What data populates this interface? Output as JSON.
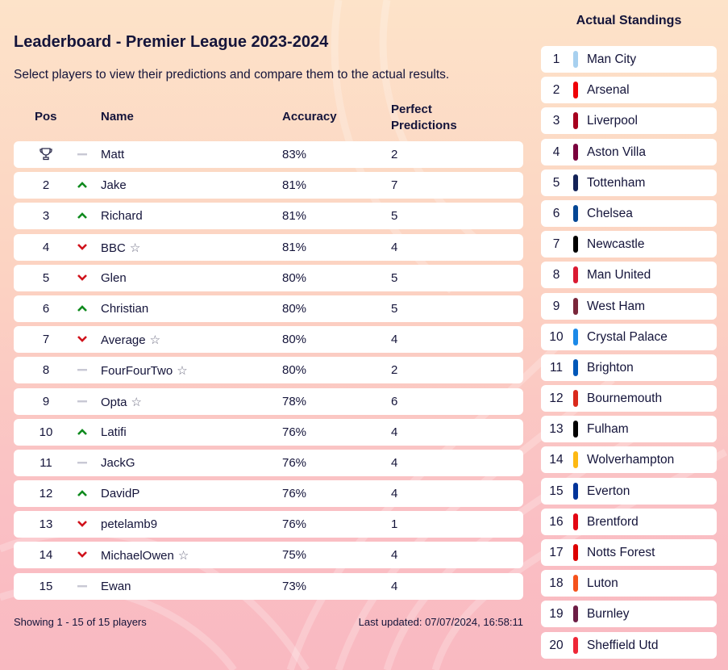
{
  "leaderboard": {
    "title": "Leaderboard - Premier League 2023-2024",
    "subtitle": "Select players to view their predictions and compare them to the actual results.",
    "columns": {
      "pos": "Pos",
      "name": "Name",
      "accuracy": "Accuracy",
      "perfect_line1": "Perfect",
      "perfect_line2": "Predictions"
    },
    "rows": [
      {
        "pos": "1",
        "trophy": true,
        "trend": "same",
        "name": "Matt",
        "star": false,
        "accuracy": "83%",
        "perfect": "2"
      },
      {
        "pos": "2",
        "trophy": false,
        "trend": "up",
        "name": "Jake",
        "star": false,
        "accuracy": "81%",
        "perfect": "7"
      },
      {
        "pos": "3",
        "trophy": false,
        "trend": "up",
        "name": "Richard",
        "star": false,
        "accuracy": "81%",
        "perfect": "5"
      },
      {
        "pos": "4",
        "trophy": false,
        "trend": "down",
        "name": "BBC",
        "star": true,
        "accuracy": "81%",
        "perfect": "4"
      },
      {
        "pos": "5",
        "trophy": false,
        "trend": "down",
        "name": "Glen",
        "star": false,
        "accuracy": "80%",
        "perfect": "5"
      },
      {
        "pos": "6",
        "trophy": false,
        "trend": "up",
        "name": "Christian",
        "star": false,
        "accuracy": "80%",
        "perfect": "5"
      },
      {
        "pos": "7",
        "trophy": false,
        "trend": "down",
        "name": "Average",
        "star": true,
        "accuracy": "80%",
        "perfect": "4"
      },
      {
        "pos": "8",
        "trophy": false,
        "trend": "same",
        "name": "FourFourTwo",
        "star": true,
        "accuracy": "80%",
        "perfect": "2"
      },
      {
        "pos": "9",
        "trophy": false,
        "trend": "same",
        "name": "Opta",
        "star": true,
        "accuracy": "78%",
        "perfect": "6"
      },
      {
        "pos": "10",
        "trophy": false,
        "trend": "up",
        "name": "Latifi",
        "star": false,
        "accuracy": "76%",
        "perfect": "4"
      },
      {
        "pos": "11",
        "trophy": false,
        "trend": "same",
        "name": "JackG",
        "star": false,
        "accuracy": "76%",
        "perfect": "4"
      },
      {
        "pos": "12",
        "trophy": false,
        "trend": "up",
        "name": "DavidP",
        "star": false,
        "accuracy": "76%",
        "perfect": "4"
      },
      {
        "pos": "13",
        "trophy": false,
        "trend": "down",
        "name": "petelamb9",
        "star": false,
        "accuracy": "76%",
        "perfect": "1"
      },
      {
        "pos": "14",
        "trophy": false,
        "trend": "down",
        "name": "MichaelOwen",
        "star": true,
        "accuracy": "75%",
        "perfect": "4"
      },
      {
        "pos": "15",
        "trophy": false,
        "trend": "same",
        "name": "Ewan",
        "star": false,
        "accuracy": "73%",
        "perfect": "4"
      }
    ],
    "showing": "Showing 1 - 15 of 15 players",
    "last_updated": "Last updated: 07/07/2024, 16:58:11"
  },
  "icons": {
    "trophy": "trophy-icon",
    "up": "chevron-up-icon",
    "down": "chevron-down-icon",
    "same": "dash-icon",
    "star": "star-outline-icon"
  },
  "colors": {
    "up": "#0f8a1e",
    "down": "#d0121b",
    "same": "#c8c8d4",
    "text": "#14143a"
  },
  "standings": {
    "title": "Actual Standings",
    "teams": [
      {
        "pos": "1",
        "name": "Man City",
        "color": "#a7d0ef"
      },
      {
        "pos": "2",
        "name": "Arsenal",
        "color": "#ef0107"
      },
      {
        "pos": "3",
        "name": "Liverpool",
        "color": "#a6001e"
      },
      {
        "pos": "4",
        "name": "Aston Villa",
        "color": "#7a003c"
      },
      {
        "pos": "5",
        "name": "Tottenham",
        "color": "#132257"
      },
      {
        "pos": "6",
        "name": "Chelsea",
        "color": "#034694"
      },
      {
        "pos": "7",
        "name": "Newcastle",
        "color": "#000000"
      },
      {
        "pos": "8",
        "name": "Man United",
        "color": "#da1a32"
      },
      {
        "pos": "9",
        "name": "West Ham",
        "color": "#7a263a"
      },
      {
        "pos": "10",
        "name": "Crystal Palace",
        "color": "#1b89e8"
      },
      {
        "pos": "11",
        "name": "Brighton",
        "color": "#0057b8"
      },
      {
        "pos": "12",
        "name": "Bournemouth",
        "color": "#da291c"
      },
      {
        "pos": "13",
        "name": "Fulham",
        "color": "#000000"
      },
      {
        "pos": "14",
        "name": "Wolverhampton",
        "color": "#fdb913"
      },
      {
        "pos": "15",
        "name": "Everton",
        "color": "#003399"
      },
      {
        "pos": "16",
        "name": "Brentford",
        "color": "#e30613"
      },
      {
        "pos": "17",
        "name": "Notts Forest",
        "color": "#dd0000"
      },
      {
        "pos": "18",
        "name": "Luton",
        "color": "#f5521b"
      },
      {
        "pos": "19",
        "name": "Burnley",
        "color": "#6c1d45"
      },
      {
        "pos": "20",
        "name": "Sheffield Utd",
        "color": "#ee2737"
      }
    ]
  }
}
